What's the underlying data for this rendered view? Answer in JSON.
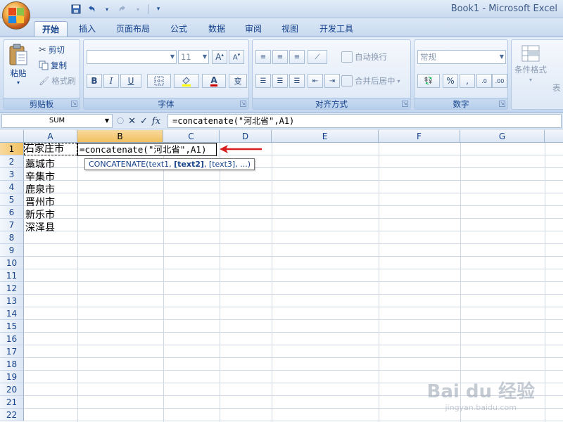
{
  "window": {
    "title": "Book1 - Microsoft Excel"
  },
  "tabs": [
    {
      "label": "开始",
      "active": true
    },
    {
      "label": "插入"
    },
    {
      "label": "页面布局"
    },
    {
      "label": "公式"
    },
    {
      "label": "数据"
    },
    {
      "label": "审阅"
    },
    {
      "label": "视图"
    },
    {
      "label": "开发工具"
    }
  ],
  "ribbon": {
    "clipboard": {
      "label": "剪贴板",
      "paste": "粘贴",
      "cut": "剪切",
      "copy": "复制",
      "format_painter": "格式刷"
    },
    "font": {
      "label": "字体",
      "font_name": "",
      "font_size": "11",
      "bold": "B",
      "italic": "I",
      "underline": "U"
    },
    "alignment": {
      "label": "对齐方式",
      "wrap_text": "自动换行",
      "merge_center": "合并后居中"
    },
    "number": {
      "label": "数字",
      "format": "常规",
      "percent": "%",
      "comma": ","
    },
    "styles": {
      "conditional_format": "条件格式",
      "partial": "表"
    }
  },
  "formula_bar": {
    "name_box": "SUM",
    "cancel": "✕",
    "enter": "✓",
    "fx": "fx",
    "content": "=concatenate(\"河北省\",A1)"
  },
  "columns": [
    "A",
    "B",
    "C",
    "D",
    "E",
    "F",
    "G"
  ],
  "rows": [
    "1",
    "2",
    "3",
    "4",
    "5",
    "6",
    "7",
    "8",
    "9",
    "10",
    "11",
    "12",
    "13",
    "14",
    "15",
    "16",
    "17",
    "18",
    "19",
    "20",
    "21",
    "22"
  ],
  "cells": {
    "A1": "石家庄市",
    "A2": "藁城市",
    "A3": "辛集市",
    "A4": "鹿泉市",
    "A5": "晋州市",
    "A6": "新乐市",
    "A7": "深泽县",
    "B1_edit": "=concatenate(\"河北省\",A1)"
  },
  "tooltip": {
    "prefix": "CONCATENATE(text1, ",
    "bold": "[text2]",
    "suffix": ", [text3], ...)"
  },
  "watermark": {
    "brand": "Bai du 经验",
    "url": "jingyan.baidu.com"
  }
}
